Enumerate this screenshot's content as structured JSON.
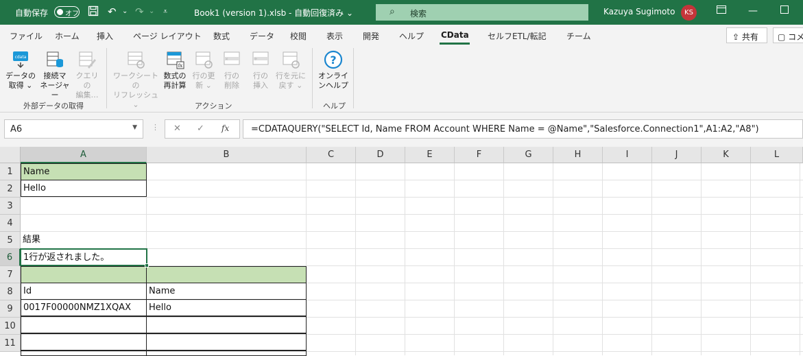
{
  "titlebar": {
    "autosave_label": "自動保存",
    "autosave_state": "オフ",
    "document_title": "Book1 (version 1).xlsb  -  自動回復済み  ⌄",
    "search_placeholder": "検索",
    "user_name": "Kazuya Sugimoto",
    "user_initials": "KS"
  },
  "ribbon_tabs": [
    "ファイル",
    "ホーム",
    "挿入",
    "ページ レイアウト",
    "数式",
    "データ",
    "校閲",
    "表示",
    "開発",
    "ヘルプ",
    "CData",
    "セルフETL/転記",
    "チーム"
  ],
  "active_tab": "CData",
  "share_label": "共有",
  "comment_label": "コメ",
  "ribbon": {
    "buttons": {
      "get_data": [
        "データの",
        "取得 ⌄"
      ],
      "connection_manager": [
        "接続マ",
        "ネージャー"
      ],
      "query_edit": [
        "クエリの",
        "編集…"
      ],
      "worksheet_refresh": [
        "ワークシートの",
        "リフレッシュ ⌄"
      ],
      "recalc_formula": [
        "数式の",
        "再計算"
      ],
      "update_row": [
        "行の更",
        "新 ⌄"
      ],
      "delete_row": [
        "行の",
        "削除"
      ],
      "insert_row": [
        "行の",
        "挿入"
      ],
      "revert_row": [
        "行を元に",
        "戻す ⌄"
      ],
      "online_help": [
        "オンライ",
        "ンヘルプ"
      ]
    },
    "groups": {
      "external": "外部データの取得",
      "action": "アクション",
      "help": "ヘルプ"
    }
  },
  "formula_bar": {
    "name_box": "A6",
    "formula": "=CDATAQUERY(\"SELECT Id, Name FROM Account WHERE Name = @Name\",\"Salesforce.Connection1\",A1:A2,\"A8\")"
  },
  "columns": [
    "A",
    "B",
    "C",
    "D",
    "E",
    "F",
    "G",
    "H",
    "I",
    "J",
    "K",
    "L"
  ],
  "rows": [
    "1",
    "2",
    "3",
    "4",
    "5",
    "6",
    "7",
    "8",
    "9",
    "10",
    "11"
  ],
  "cells": {
    "A1": "Name",
    "A2": "Hello",
    "A5": "結果",
    "A6": "1行が返されました。",
    "A8": "Id",
    "B8": "Name",
    "A9": "0017F00000NMZ1XQAX",
    "B9": "Hello"
  },
  "colors": {
    "excel_green": "#217346",
    "header_fill": "#c6e0b4"
  }
}
